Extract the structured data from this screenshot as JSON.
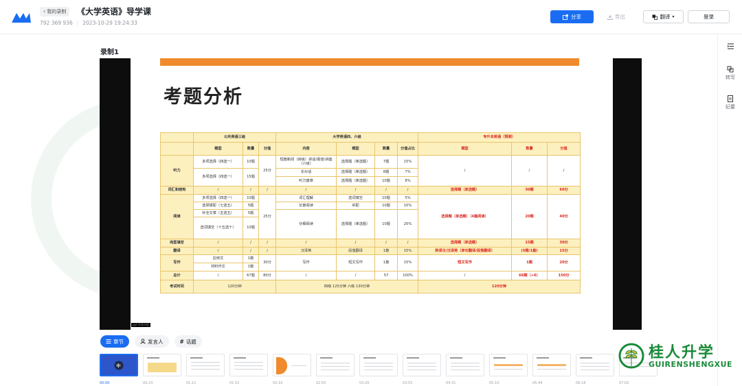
{
  "header": {
    "back_label": "我的录制",
    "title": "《大学英语》导学课",
    "meeting_id": "792 369 936",
    "datetime": "2023-10-29 19:24:33",
    "share_label": "分享",
    "export_label": "导出",
    "translate_label": "翻译",
    "login_label": "登录"
  },
  "right_rail": {
    "item2_label": "转写",
    "item3_label": "纪要"
  },
  "recording": {
    "title": "录制1"
  },
  "slide": {
    "title": "考题分析",
    "caption": "ppt:共享内容"
  },
  "table": {
    "h_cet3": "公共英语三级",
    "h_cet46": "大学英语四、六级",
    "h_zsb": "专升本英语（预测）",
    "c_type": "题型",
    "c_count": "数量",
    "c_score": "分值",
    "c_content": "内容",
    "c_type2": "题型",
    "c_count2": "数量",
    "c_ratio": "分值占比",
    "c_type3": "题型",
    "c_count3": "数量",
    "c_score3": "分值",
    "listening": "听力",
    "l1_t": "多项选择（四选一）",
    "l1_n": "10题",
    "l2_t": "多项选择（四选一）",
    "l2_n": "15题",
    "l_score": "25分",
    "l_c1": "短篇新闻（四级）讲话/报道/讲座（六级）",
    "l_c1_t": "选择题（单选题）",
    "l_c1_n": "7题",
    "l_c1_r": "15%",
    "l_c2": "长对话",
    "l_c2_t": "选择题（单选题）",
    "l_c2_n": "8题",
    "l_c2_r": "7%",
    "l_c3": "听力篇章",
    "l_c3_t": "选择题（单选题）",
    "l_c3_n": "10题",
    "l_c3_r": "8%",
    "slash": "/",
    "vocab": "词汇和结构",
    "vocab_t": "选择题（单选题）",
    "vocab_n": "30题",
    "vocab_s": "60分",
    "reading": "阅读",
    "r1_t": "多项选择（四选一）",
    "r1_n": "10题",
    "r2_t": "选择搭配（七选五）",
    "r2_n": "5题",
    "r3_t": "补全文章（五选五）",
    "r3_n": "5题",
    "r4_t": "选词填空（十五选十）",
    "r4_n": "10题",
    "r_score": "25分",
    "r_c1": "词汇理解",
    "r_c1_t": "选词填空",
    "r_c1_n": "10题",
    "r_c1_r": "5%",
    "r_c2": "长篇阅读",
    "r_c2_t": "匹配",
    "r_c2_n": "10题",
    "r_c2_r": "10%",
    "r_c3": "仔细阅读",
    "r_c3_t": "选择题（单选题）",
    "r_c3_n": "10题",
    "r_c3_r": "20%",
    "r_z_t": "选择题（单选题）（4篇阅读）",
    "r_z_n": "20题",
    "r_z_s": "40分",
    "cloze": "完型填空",
    "cloze_t": "选择题（单选题）",
    "cloze_n": "15题",
    "cloze_s": "30分",
    "trans": "翻译",
    "trans_c": "汉译英",
    "trans_t": "段落翻译",
    "trans_n": "1篇",
    "trans_r": "15%",
    "trans_z_t": "英译汉/汉译英（单句翻译/段落翻译）",
    "trans_z_n": "(5题/1篇)",
    "trans_z_s": "15分",
    "writing": "写作",
    "w1_t": "应用文",
    "w1_n": "1篇",
    "w2_t": "材料作文",
    "w2_n": "1篇",
    "w_score": "30分",
    "w_c": "写作",
    "w_c_t": "短文写作",
    "w_c_n": "1篇",
    "w_c_r": "15%",
    "w_z_t": "短文写作",
    "w_z_n": "1题",
    "w_z_s": "20分",
    "total": "总计",
    "t_n": "67题",
    "t_s": "80分",
    "t_c_n": "57",
    "t_c_r": "100%",
    "t_z_n": "66题（+6）",
    "t_z_s": "150分",
    "time": "考试时间",
    "time_1": "120分钟",
    "time_2": "四级 125分钟 六级 130分钟",
    "time_3": "120分钟"
  },
  "tabs": {
    "chapters": "章节",
    "speakers": "发言人",
    "topics": "话题"
  },
  "timestamps": [
    "00:00",
    "00:23",
    "01:11",
    "01:52",
    "02:16",
    "02:50",
    "03:20",
    "03:55",
    "04:31",
    "05:10",
    "05:44",
    "06:18",
    "07:02"
  ],
  "brand": {
    "cn": "桂人升学",
    "en": "GUIRENSHENGXUE"
  },
  "colors": {
    "accent": "#1a6df2",
    "slide_bar": "#f08a2c",
    "table_header": "#fdf0bf",
    "highlight_red": "#d9261c",
    "brand_green": "#1a8a3a"
  }
}
